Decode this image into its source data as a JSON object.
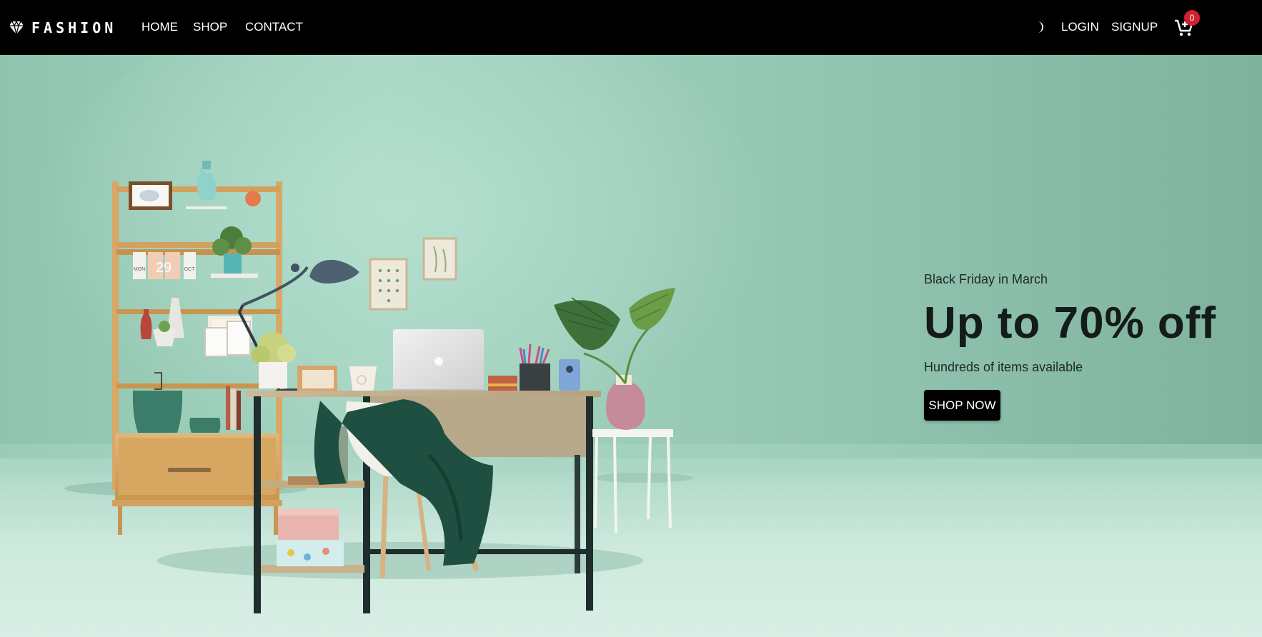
{
  "brand": {
    "name": "FASHION",
    "logo_icon": "diamond-icon"
  },
  "nav": {
    "home": "HOME",
    "shop": "SHOP",
    "contact": "CONTACT"
  },
  "actions": {
    "theme_icon": "moon-icon",
    "login": "LOGIN",
    "signup": "SIGNUP",
    "cart_icon": "cart-plus-icon",
    "cart_count": "0"
  },
  "hero": {
    "eyebrow": "Black Friday in March",
    "title": "Up to 70% off",
    "subtitle": "Hundreds of items available",
    "cta": "SHOP NOW",
    "calendar": {
      "day": "MON",
      "date": "29",
      "month": "OCT"
    }
  },
  "colors": {
    "navbar": "#000000",
    "wall": "#9fd0bd",
    "badge": "#d32030",
    "cta_bg": "#000000"
  }
}
